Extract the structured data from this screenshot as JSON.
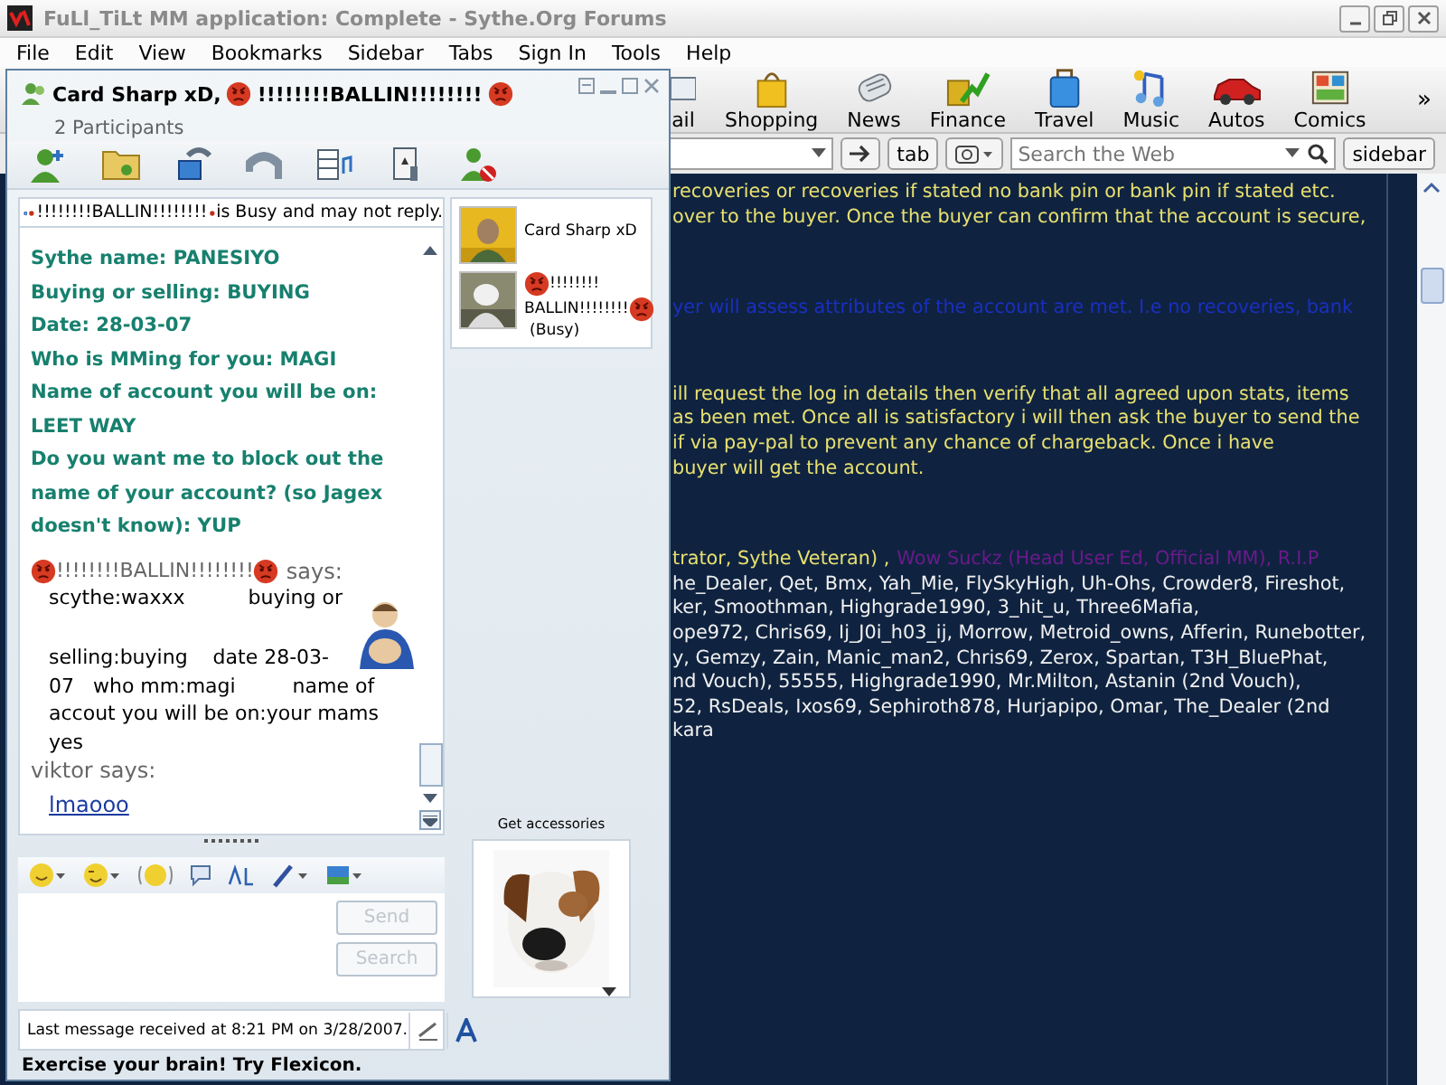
{
  "browser": {
    "title": "FuLl_TiLt MM application: Complete - Sythe.Org Forums",
    "menu": [
      "File",
      "Edit",
      "View",
      "Bookmarks",
      "Sidebar",
      "Tabs",
      "Sign In",
      "Tools",
      "Help"
    ],
    "toolbar": [
      {
        "label": "ail",
        "kind": "mail"
      },
      {
        "label": "Shopping",
        "kind": "shopping"
      },
      {
        "label": "News",
        "kind": "news"
      },
      {
        "label": "Finance",
        "kind": "finance"
      },
      {
        "label": "Travel",
        "kind": "travel"
      },
      {
        "label": "Music",
        "kind": "music"
      },
      {
        "label": "Autos",
        "kind": "autos"
      },
      {
        "label": "Comics",
        "kind": "comics"
      }
    ],
    "more": "»",
    "tab_button": "tab",
    "search": {
      "placeholder": "Search the Web"
    },
    "sidebar_button": "sidebar"
  },
  "forum": {
    "blocks": [
      [
        [
          {
            "text": "recoveries or recoveries if stated no bank pin or bank pin if stated etc.",
            "color": "#e8e070"
          }
        ],
        [
          {
            "text": "over to the buyer. Once the buyer can confirm that the account is secure,",
            "color": "#e8e070"
          }
        ]
      ],
      [
        [
          {
            "text": "yer will assess attributes of the account are met. I.e no recoveries, bank",
            "color": "#1a2fc0"
          }
        ]
      ],
      [
        [
          {
            "text": "ill request the log in details then verify that all agreed upon stats, items",
            "color": "#e8e070"
          }
        ],
        [
          {
            "text": "as been met. Once all is satisfactory i will then ask the buyer to send the",
            "color": "#e8e070"
          }
        ],
        [
          {
            "text": "if via pay-pal to prevent any chance of chargeback. Once i have",
            "color": "#e8e070"
          }
        ],
        [
          {
            "text": "buyer will get the account.",
            "color": "#e8e070"
          }
        ]
      ],
      [
        [
          {
            "text": "trator, Sythe Veteran) ,",
            "color": "#e8e070"
          },
          {
            "text": "Wow Suckz (Head User Ed, Official MM), R.I.P",
            "color": "#6a1a8a"
          }
        ],
        [
          {
            "text": "he_Dealer, Qet, Bmx, Yah_Mie, FlySkyHigh, Uh-Ohs, Crowder8, Fireshot,",
            "color": "#f0f0f0"
          }
        ],
        [
          {
            "text": "ker, Smoothman, Highgrade1990, 3_hit_u, Three6Mafia,",
            "color": "#f0f0f0"
          }
        ],
        [
          {
            "text": "ope972, Chris69, Ij_J0i_h03_ij, Morrow, Metroid_owns, Afferin, Runebotter,",
            "color": "#f0f0f0"
          }
        ],
        [
          {
            "text": "y, Gemzy, Zain, Manic_man2, Chris69, Zerox, Spartan, T3H_BluePhat,",
            "color": "#f0f0f0"
          }
        ],
        [
          {
            "text": "nd Vouch), 55555, Highgrade1990, Mr.Milton, Astanin (2nd Vouch),",
            "color": "#f0f0f0"
          }
        ],
        [
          {
            "text": "52, RsDeals, Ixos69, Sephiroth878, Hurjapipo, Omar, The_Dealer (2nd",
            "color": "#f0f0f0"
          }
        ],
        [
          {
            "text": "kara",
            "color": "#f0f0f0"
          }
        ]
      ]
    ]
  },
  "chat": {
    "title": "Card Sharp xD,",
    "contact": "!!!!!!!!BALLIN!!!!!!!!",
    "participants_count": "2 Participants",
    "info_contact": "!!!!!!!!BALLIN!!!!!!!!",
    "info": "is Busy and may not reply.",
    "form_lines": [
      "Sythe name: PANESIYO",
      "Buying or selling: BUYING",
      "Date: 28-03-07",
      "Who is MMing for you: MAGI",
      "Name of account you will be on:",
      "LEET WAY",
      "Do you want me to block out the",
      "name of your account? (so Jagex",
      "doesn't know): YUP"
    ],
    "reply": {
      "sender": "!!!!!!!!BALLIN!!!!!!!!",
      "says": "says:",
      "first_line": "scythe:waxxx          buying or",
      "lines": [
        "selling:buying    date 28-03-",
        "07   who mm:magi         name of",
        "accout you will be on:your mams",
        "yes"
      ]
    },
    "last": {
      "sender": "viktor says:",
      "link": "lmaooo"
    },
    "participants": [
      {
        "name": "Card Sharp xD",
        "kind": "picture"
      },
      {
        "name": "!!!!!!!!",
        "name_2": "BALLIN!!!!!!!!",
        "status": "(Busy)",
        "kind": "picture"
      }
    ],
    "buttons": [
      {
        "label": "Send",
        "disabled": true
      },
      {
        "label": "Search",
        "disabled": true
      }
    ],
    "status": "Last message received at 8:21 PM on 3/28/2007.",
    "accessories": "Get accessories",
    "footer": "Exercise your brain! Try Flexicon."
  }
}
